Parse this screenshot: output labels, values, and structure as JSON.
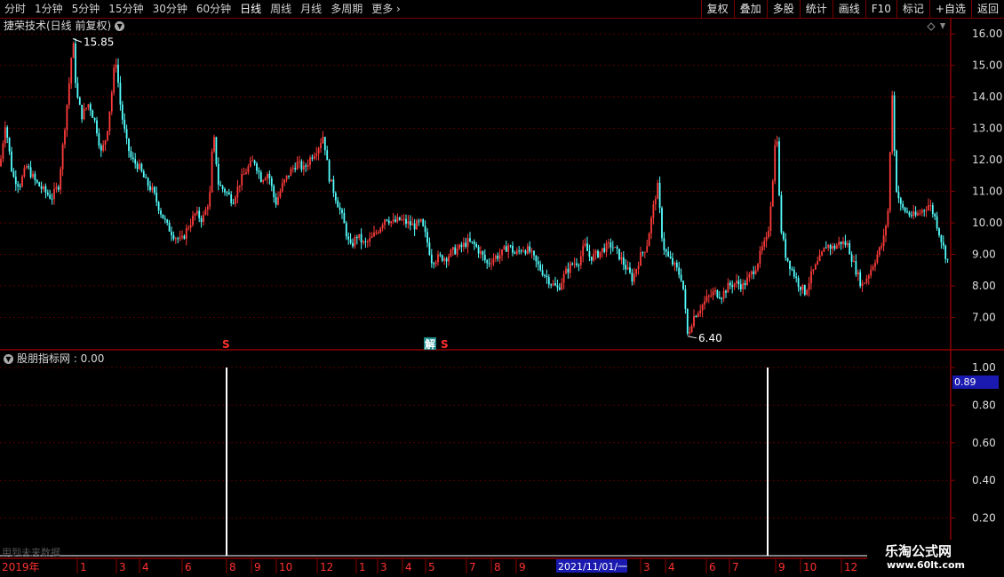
{
  "toolbar": {
    "periods": [
      "分时",
      "1分钟",
      "5分钟",
      "15分钟",
      "30分钟",
      "60分钟",
      "日线",
      "周线",
      "月线",
      "多周期",
      "更多"
    ],
    "active_period": "日线",
    "more_icon": "chevron-right-icon",
    "buttons": [
      "复权",
      "叠加",
      "多股",
      "统计",
      "画线",
      "F10",
      "标记",
      "+自选",
      "返回"
    ]
  },
  "main_chart": {
    "title": "捷荣技术(日线 前复权)",
    "high_label": "15.85",
    "low_label": "6.40",
    "price_ticks": [
      "16.00",
      "15.00",
      "14.00",
      "13.00",
      "12.00",
      "11.00",
      "10.00",
      "9.00",
      "8.00",
      "7.00"
    ],
    "markers": [
      "S",
      "解",
      "S"
    ]
  },
  "indicator": {
    "title": "股朋指标网 : 0.00",
    "ticks": [
      "1.00",
      "0.80",
      "0.60",
      "0.40",
      "0.20"
    ],
    "cursor_value": "0.89",
    "future_note": "用到未来数据"
  },
  "date_axis": {
    "year_label": "2019年",
    "months": [
      "1",
      "3",
      "4",
      "6",
      "8",
      "9",
      "10",
      "12",
      "1",
      "3",
      "4",
      "5",
      "7",
      "8",
      "9",
      "3",
      "4",
      "6",
      "7",
      "9",
      "10",
      "12"
    ],
    "highlight_label": "2021/11/01/一"
  },
  "watermark": {
    "title": "乐淘公式网",
    "url": "www.60lt.com"
  },
  "colors": {
    "up": "#ff3b3b",
    "down": "#54ffff",
    "frame": "#8b0000",
    "grid": "#5a0000"
  },
  "chart_data": {
    "type": "candlestick",
    "ylim": [
      6.0,
      16.4
    ],
    "close_path": [
      [
        0,
        11.8
      ],
      [
        6,
        13.2
      ],
      [
        14,
        11.5
      ],
      [
        22,
        11.2
      ],
      [
        30,
        11.8
      ],
      [
        40,
        11.3
      ],
      [
        50,
        11.0
      ],
      [
        58,
        10.8
      ],
      [
        66,
        11.2
      ],
      [
        72,
        12.8
      ],
      [
        78,
        14.5
      ],
      [
        82,
        15.85
      ],
      [
        86,
        14.1
      ],
      [
        92,
        13.4
      ],
      [
        100,
        13.8
      ],
      [
        108,
        13.1
      ],
      [
        114,
        12.2
      ],
      [
        120,
        12.8
      ],
      [
        126,
        14.2
      ],
      [
        130,
        15.3
      ],
      [
        136,
        13.6
      ],
      [
        142,
        12.6
      ],
      [
        148,
        12.0
      ],
      [
        156,
        11.8
      ],
      [
        164,
        11.3
      ],
      [
        172,
        11.0
      ],
      [
        180,
        10.4
      ],
      [
        188,
        9.9
      ],
      [
        196,
        9.6
      ],
      [
        204,
        9.4
      ],
      [
        212,
        9.9
      ],
      [
        220,
        10.3
      ],
      [
        228,
        10.1
      ],
      [
        236,
        10.8
      ],
      [
        240,
        12.9
      ],
      [
        246,
        11.2
      ],
      [
        254,
        11.0
      ],
      [
        262,
        10.7
      ],
      [
        270,
        11.3
      ],
      [
        278,
        11.7
      ],
      [
        286,
        12.0
      ],
      [
        294,
        11.4
      ],
      [
        302,
        11.6
      ],
      [
        310,
        10.6
      ],
      [
        318,
        11.2
      ],
      [
        326,
        11.6
      ],
      [
        334,
        11.9
      ],
      [
        342,
        11.7
      ],
      [
        350,
        12.1
      ],
      [
        358,
        12.4
      ],
      [
        364,
        12.8
      ],
      [
        370,
        11.5
      ],
      [
        378,
        10.8
      ],
      [
        386,
        10.1
      ],
      [
        394,
        9.2
      ],
      [
        402,
        9.6
      ],
      [
        410,
        9.3
      ],
      [
        418,
        9.5
      ],
      [
        426,
        9.8
      ],
      [
        434,
        10.2
      ],
      [
        442,
        10.0
      ],
      [
        450,
        10.1
      ],
      [
        458,
        10.0
      ],
      [
        466,
        9.9
      ],
      [
        474,
        10.0
      ],
      [
        480,
        9.5
      ],
      [
        486,
        8.8
      ],
      [
        494,
        8.9
      ],
      [
        502,
        8.9
      ],
      [
        510,
        9.1
      ],
      [
        518,
        9.2
      ],
      [
        526,
        9.4
      ],
      [
        534,
        9.3
      ],
      [
        542,
        9.0
      ],
      [
        548,
        8.7
      ],
      [
        556,
        8.9
      ],
      [
        564,
        9.0
      ],
      [
        572,
        9.3
      ],
      [
        580,
        9.0
      ],
      [
        588,
        9.2
      ],
      [
        596,
        9.1
      ],
      [
        604,
        8.7
      ],
      [
        612,
        8.4
      ],
      [
        620,
        8.1
      ],
      [
        628,
        7.9
      ],
      [
        636,
        8.4
      ],
      [
        644,
        8.7
      ],
      [
        652,
        8.8
      ],
      [
        658,
        9.3
      ],
      [
        664,
        8.9
      ],
      [
        672,
        9.0
      ],
      [
        680,
        9.2
      ],
      [
        688,
        9.3
      ],
      [
        696,
        9.0
      ],
      [
        704,
        8.6
      ],
      [
        712,
        8.2
      ],
      [
        720,
        8.9
      ],
      [
        728,
        9.3
      ],
      [
        736,
        10.6
      ],
      [
        740,
        11.2
      ],
      [
        746,
        9.3
      ],
      [
        752,
        8.9
      ],
      [
        760,
        8.6
      ],
      [
        768,
        8.2
      ],
      [
        774,
        6.4
      ],
      [
        780,
        7.0
      ],
      [
        788,
        7.3
      ],
      [
        796,
        7.6
      ],
      [
        804,
        7.8
      ],
      [
        812,
        7.7
      ],
      [
        820,
        8.0
      ],
      [
        828,
        8.1
      ],
      [
        836,
        8.0
      ],
      [
        844,
        8.3
      ],
      [
        852,
        8.7
      ],
      [
        858,
        9.2
      ],
      [
        864,
        9.5
      ],
      [
        870,
        11.5
      ],
      [
        874,
        13.2
      ],
      [
        878,
        10.0
      ],
      [
        884,
        9.0
      ],
      [
        890,
        8.6
      ],
      [
        898,
        8.1
      ],
      [
        906,
        7.8
      ],
      [
        914,
        8.4
      ],
      [
        922,
        8.8
      ],
      [
        930,
        9.3
      ],
      [
        938,
        9.2
      ],
      [
        946,
        9.4
      ],
      [
        954,
        9.3
      ],
      [
        962,
        8.6
      ],
      [
        970,
        8.0
      ],
      [
        978,
        8.4
      ],
      [
        986,
        8.9
      ],
      [
        994,
        9.4
      ],
      [
        1000,
        10.5
      ],
      [
        1004,
        14.3
      ],
      [
        1008,
        11.2
      ],
      [
        1014,
        10.5
      ],
      [
        1022,
        10.3
      ],
      [
        1030,
        10.2
      ],
      [
        1038,
        10.4
      ],
      [
        1046,
        10.6
      ],
      [
        1052,
        10.2
      ],
      [
        1058,
        9.6
      ],
      [
        1064,
        9.0
      ],
      [
        1070,
        8.6
      ]
    ],
    "signal_bars": [
      [
        255,
        1.0
      ],
      [
        864,
        1.0
      ]
    ]
  }
}
